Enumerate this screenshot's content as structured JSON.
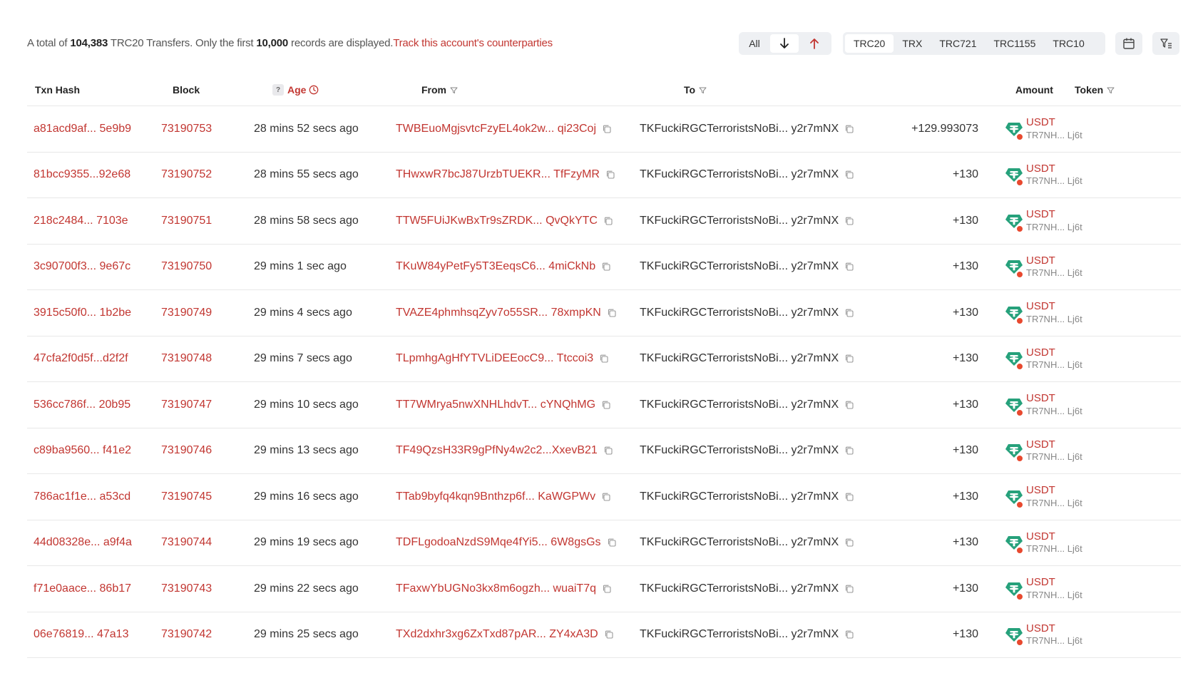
{
  "summary": {
    "prefix": "A total of",
    "total": "104,383",
    "middle": "TRC20 Transfers. Only the first",
    "limit": "10,000",
    "suffix": "records are displayed.",
    "track_link": "Track this account's counterparties"
  },
  "direction": {
    "all": "All",
    "down_icon": "arrow-down-icon",
    "up_icon": "arrow-up-icon"
  },
  "type_tabs": [
    "TRC20",
    "TRX",
    "TRC721",
    "TRC1155",
    "TRC10"
  ],
  "active_tab": "TRC20",
  "icons": {
    "calendar": "calendar-icon",
    "column_filter": "column-filter-icon"
  },
  "columns": {
    "txn_hash": "Txn Hash",
    "block": "Block",
    "age": "Age",
    "from": "From",
    "to": "To",
    "amount": "Amount",
    "token": "Token"
  },
  "rows": [
    {
      "hash": "a81acd9af... 5e9b9",
      "block": "73190753",
      "age": "28 mins 52 secs ago",
      "from": "TWBEuoMgjsvtcFzyEL4ok2w... qi23Coj",
      "to": "TKFuckiRGCTerroristsNoBi... y2r7mNX",
      "amount": "+129.993073",
      "token": "USDT",
      "token_addr": "TR7NH... Lj6t"
    },
    {
      "hash": "81bcc9355...92e68",
      "block": "73190752",
      "age": "28 mins 55 secs ago",
      "from": "THwxwR7bcJ87UrzbTUEKR... TfFzyMR",
      "to": "TKFuckiRGCTerroristsNoBi... y2r7mNX",
      "amount": "+130",
      "token": "USDT",
      "token_addr": "TR7NH... Lj6t"
    },
    {
      "hash": "218c2484... 7103e",
      "block": "73190751",
      "age": "28 mins 58 secs ago",
      "from": "TTW5FUiJKwBxTr9sZRDK... QvQkYTC",
      "to": "TKFuckiRGCTerroristsNoBi... y2r7mNX",
      "amount": "+130",
      "token": "USDT",
      "token_addr": "TR7NH... Lj6t"
    },
    {
      "hash": "3c90700f3... 9e67c",
      "block": "73190750",
      "age": "29 mins 1 sec ago",
      "from": "TKuW84yPetFy5T3EeqsC6... 4miCkNb",
      "to": "TKFuckiRGCTerroristsNoBi... y2r7mNX",
      "amount": "+130",
      "token": "USDT",
      "token_addr": "TR7NH... Lj6t"
    },
    {
      "hash": "3915c50f0... 1b2be",
      "block": "73190749",
      "age": "29 mins 4 secs ago",
      "from": "TVAZE4phmhsqZyv7o55SR... 78xmpKN",
      "to": "TKFuckiRGCTerroristsNoBi... y2r7mNX",
      "amount": "+130",
      "token": "USDT",
      "token_addr": "TR7NH... Lj6t"
    },
    {
      "hash": "47cfa2f0d5f...d2f2f",
      "block": "73190748",
      "age": "29 mins 7 secs ago",
      "from": "TLpmhgAgHfYTVLiDEEocC9... Ttccoi3",
      "to": "TKFuckiRGCTerroristsNoBi... y2r7mNX",
      "amount": "+130",
      "token": "USDT",
      "token_addr": "TR7NH... Lj6t"
    },
    {
      "hash": "536cc786f... 20b95",
      "block": "73190747",
      "age": "29 mins 10 secs ago",
      "from": "TT7WMrya5nwXNHLhdvT... cYNQhMG",
      "to": "TKFuckiRGCTerroristsNoBi... y2r7mNX",
      "amount": "+130",
      "token": "USDT",
      "token_addr": "TR7NH... Lj6t"
    },
    {
      "hash": "c89ba9560... f41e2",
      "block": "73190746",
      "age": "29 mins 13 secs ago",
      "from": "TF49QzsH33R9gPfNy4w2c2...XxevB21",
      "to": "TKFuckiRGCTerroristsNoBi... y2r7mNX",
      "amount": "+130",
      "token": "USDT",
      "token_addr": "TR7NH... Lj6t"
    },
    {
      "hash": "786ac1f1e... a53cd",
      "block": "73190745",
      "age": "29 mins 16 secs ago",
      "from": "TTab9byfq4kqn9Bnthzp6f... KaWGPWv",
      "to": "TKFuckiRGCTerroristsNoBi... y2r7mNX",
      "amount": "+130",
      "token": "USDT",
      "token_addr": "TR7NH... Lj6t"
    },
    {
      "hash": "44d08328e... a9f4a",
      "block": "73190744",
      "age": "29 mins 19 secs ago",
      "from": "TDFLgodoaNzdS9Mqe4fYi5... 6W8gsGs",
      "to": "TKFuckiRGCTerroristsNoBi... y2r7mNX",
      "amount": "+130",
      "token": "USDT",
      "token_addr": "TR7NH... Lj6t"
    },
    {
      "hash": "f71e0aace... 86b17",
      "block": "73190743",
      "age": "29 mins 22 secs ago",
      "from": "TFaxwYbUGNo3kx8m6ogzh... wuaiT7q",
      "to": "TKFuckiRGCTerroristsNoBi... y2r7mNX",
      "amount": "+130",
      "token": "USDT",
      "token_addr": "TR7NH... Lj6t"
    },
    {
      "hash": "06e76819... 47a13",
      "block": "73190742",
      "age": "29 mins 25 secs ago",
      "from": "TXd2dxhr3xg6ZxTxd87pAR... ZY4xA3D",
      "to": "TKFuckiRGCTerroristsNoBi... y2r7mNX",
      "amount": "+130",
      "token": "USDT",
      "token_addr": "TR7NH... Lj6t"
    }
  ],
  "colors": {
    "accent": "#c23631",
    "tether": "#26a17b",
    "badge_dot": "#e8492f"
  }
}
